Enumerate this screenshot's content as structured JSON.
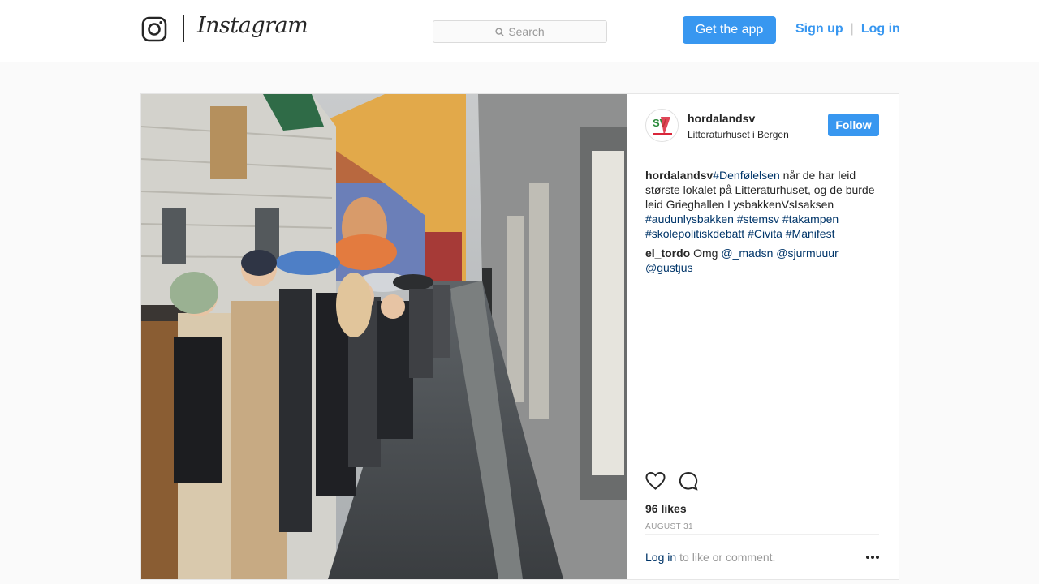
{
  "header": {
    "brand": "Instagram",
    "search_placeholder": "Search",
    "get_app": "Get the app",
    "sign_up": "Sign up",
    "separator": "|",
    "log_in": "Log in"
  },
  "post": {
    "author": "hordalandsv",
    "location": "Litteraturhuset i Bergen",
    "follow": "Follow",
    "avatar_text": "SV",
    "comments": [
      {
        "user": "hordalandsv",
        "parts": [
          {
            "type": "tag",
            "text": "#Denfølelsen"
          },
          {
            "type": "text",
            "text": " når de har leid største lokalet på Litteraturhuset, og de burde leid Grieghallen LysbakkenVsIsaksen "
          },
          {
            "type": "tag",
            "text": "#audunlysbakken"
          },
          {
            "type": "text",
            "text": " "
          },
          {
            "type": "tag",
            "text": "#stemsv"
          },
          {
            "type": "text",
            "text": " "
          },
          {
            "type": "tag",
            "text": "#takampen"
          },
          {
            "type": "text",
            "text": " "
          },
          {
            "type": "tag",
            "text": "#skolepolitiskdebatt"
          },
          {
            "type": "text",
            "text": " "
          },
          {
            "type": "tag",
            "text": "#Civita"
          },
          {
            "type": "text",
            "text": " "
          },
          {
            "type": "tag",
            "text": "#Manifest"
          }
        ]
      },
      {
        "user": "el_tordo",
        "parts": [
          {
            "type": "text",
            "text": " Omg "
          },
          {
            "type": "tag",
            "text": "@_madsn"
          },
          {
            "type": "text",
            "text": " "
          },
          {
            "type": "tag",
            "text": "@sjurmuuur"
          },
          {
            "type": "text",
            "text": " "
          },
          {
            "type": "tag",
            "text": "@gustjus"
          }
        ]
      }
    ],
    "likes": "96 likes",
    "date": "AUGUST 31",
    "login_link": "Log in",
    "login_rest": "to like or comment."
  },
  "icons": [
    "instagram-glyph-icon",
    "search-icon",
    "heart-icon",
    "comment-icon",
    "more-options-icon"
  ],
  "colors": {
    "accent": "#3897f0",
    "link": "#003569",
    "muted": "#999999",
    "border": "#dbdbdb"
  }
}
